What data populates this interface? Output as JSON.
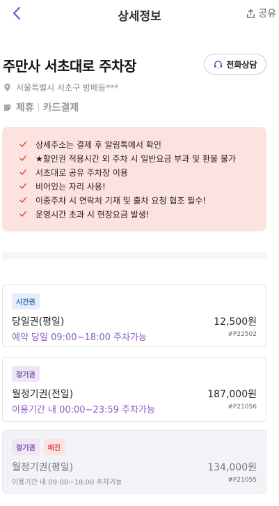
{
  "header": {
    "title": "상세정보",
    "share_label": "공유"
  },
  "lot": {
    "name": "주만사 서초대로 주차장",
    "call_label": "전화상담",
    "address": "서울특별시 서초구 방배동***",
    "tags": [
      "제휴",
      "카드결제"
    ]
  },
  "notice": [
    "상세주소는 결제 후 알림톡에서 확인",
    "★할인권 적용시간 외 주차 시 일반요금 부과 및 환불 불가",
    "서초대로 공유 주차장 이용",
    "비어있는 자리 사용!",
    "이중주차 시 연락처 기재 및 출차 요청 협조 필수!",
    "운영시간 초과 시 현장요금 발생!"
  ],
  "products": [
    {
      "badges": [
        {
          "text": "시간권",
          "type": "hour"
        }
      ],
      "name": "당일권(평일)",
      "price": "12,500원",
      "time": "예약 당일 09:00~18:00 주차가능",
      "code": "#P22502",
      "sold_out": false
    },
    {
      "badges": [
        {
          "text": "정기권",
          "type": "season"
        }
      ],
      "name": "월정기권(전일)",
      "price": "187,000원",
      "time": "이용기간 내 00:00~23:59 주차가능",
      "code": "#P21056",
      "sold_out": false
    },
    {
      "badges": [
        {
          "text": "정기권",
          "type": "season"
        },
        {
          "text": "매진",
          "type": "sold"
        }
      ],
      "name": "월정기권(평일)",
      "price": "134,000원",
      "time": "이용기간 내 09:00~18:00 주차가능",
      "code": "#P21055",
      "sold_out": true
    }
  ],
  "colors": {
    "accent": "#7b4fc2",
    "notice_bg": "#fde3df",
    "check": "#e0533f"
  }
}
